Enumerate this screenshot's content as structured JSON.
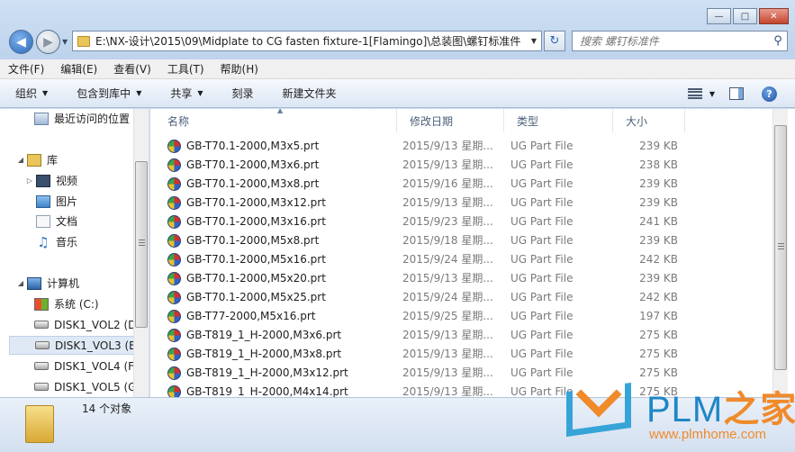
{
  "address": {
    "path": "E:\\NX-设计\\2015\\09\\Midplate to CG fasten fixture-1[Flamingo]\\总装图\\螺钉标准件"
  },
  "search": {
    "placeholder": "搜索 螺钉标准件"
  },
  "menu": [
    "文件(F)",
    "编辑(E)",
    "查看(V)",
    "工具(T)",
    "帮助(H)"
  ],
  "toolbar": {
    "organize": "组织",
    "include_library": "包含到库中",
    "share": "共享",
    "burn": "刻录",
    "new_folder": "新建文件夹"
  },
  "nav": {
    "recent": "最近访问的位置",
    "libraries": "库",
    "video": "视频",
    "pictures": "图片",
    "documents": "文档",
    "music": "音乐",
    "computer": "计算机",
    "drives": [
      "系统 (C:)",
      "DISK1_VOL2 (D",
      "DISK1_VOL3 (E:",
      "DISK1_VOL4 (F:",
      "DISK1_VOL5 (G"
    ]
  },
  "columns": {
    "name": "名称",
    "date": "修改日期",
    "type": "类型",
    "size": "大小"
  },
  "files": [
    {
      "name": "GB-T70.1-2000,M3x5.prt",
      "date": "2015/9/13 星期...",
      "type": "UG Part File",
      "size": "239 KB"
    },
    {
      "name": "GB-T70.1-2000,M3x6.prt",
      "date": "2015/9/13 星期...",
      "type": "UG Part File",
      "size": "238 KB"
    },
    {
      "name": "GB-T70.1-2000,M3x8.prt",
      "date": "2015/9/16 星期...",
      "type": "UG Part File",
      "size": "239 KB"
    },
    {
      "name": "GB-T70.1-2000,M3x12.prt",
      "date": "2015/9/13 星期...",
      "type": "UG Part File",
      "size": "239 KB"
    },
    {
      "name": "GB-T70.1-2000,M3x16.prt",
      "date": "2015/9/23 星期...",
      "type": "UG Part File",
      "size": "241 KB"
    },
    {
      "name": "GB-T70.1-2000,M5x8.prt",
      "date": "2015/9/18 星期...",
      "type": "UG Part File",
      "size": "239 KB"
    },
    {
      "name": "GB-T70.1-2000,M5x16.prt",
      "date": "2015/9/24 星期...",
      "type": "UG Part File",
      "size": "242 KB"
    },
    {
      "name": "GB-T70.1-2000,M5x20.prt",
      "date": "2015/9/13 星期...",
      "type": "UG Part File",
      "size": "239 KB"
    },
    {
      "name": "GB-T70.1-2000,M5x25.prt",
      "date": "2015/9/24 星期...",
      "type": "UG Part File",
      "size": "242 KB"
    },
    {
      "name": "GB-T77-2000,M5x16.prt",
      "date": "2015/9/25 星期...",
      "type": "UG Part File",
      "size": "197 KB"
    },
    {
      "name": "GB-T819_1_H-2000,M3x6.prt",
      "date": "2015/9/13 星期...",
      "type": "UG Part File",
      "size": "275 KB"
    },
    {
      "name": "GB-T819_1_H-2000,M3x8.prt",
      "date": "2015/9/13 星期...",
      "type": "UG Part File",
      "size": "275 KB"
    },
    {
      "name": "GB-T819_1_H-2000,M3x12.prt",
      "date": "2015/9/13 星期...",
      "type": "UG Part File",
      "size": "275 KB"
    },
    {
      "name": "GB-T819_1_H-2000,M4x14.prt",
      "date": "2015/9/13 星期...",
      "type": "UG Part File",
      "size": "275 KB"
    }
  ],
  "status": {
    "count": "14 个对象"
  },
  "watermark": {
    "brand": "PLM",
    "brand_cn": "之家",
    "url": "www.plmhome.com"
  }
}
